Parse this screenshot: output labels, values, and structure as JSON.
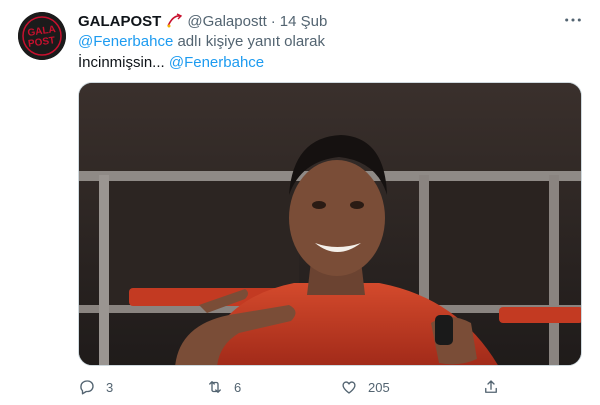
{
  "tweet": {
    "author": {
      "display_name": "GALAPOST",
      "handle": "@Galapostt",
      "separator": "·",
      "date": "14 Şub",
      "avatar_text_top": "GALA",
      "avatar_text_bottom": "POST",
      "avatar_color": "#1b1b1b",
      "avatar_accent": "#c8102e"
    },
    "reply": {
      "mention": "@Fenerbahce",
      "suffix": " adlı kişiye yanıt olarak"
    },
    "body": {
      "text": "İncinmişsin... ",
      "mention": "@Fenerbahce"
    },
    "media": {
      "alt": "video"
    },
    "actions": {
      "replies": "3",
      "retweets": "6",
      "likes": "205"
    },
    "colors": {
      "link": "#1d9bf0",
      "muted": "#536471",
      "text": "#0f1419"
    },
    "icons": [
      "more-icon",
      "badge-icon",
      "reply-icon",
      "retweet-icon",
      "like-icon",
      "share-icon"
    ]
  }
}
